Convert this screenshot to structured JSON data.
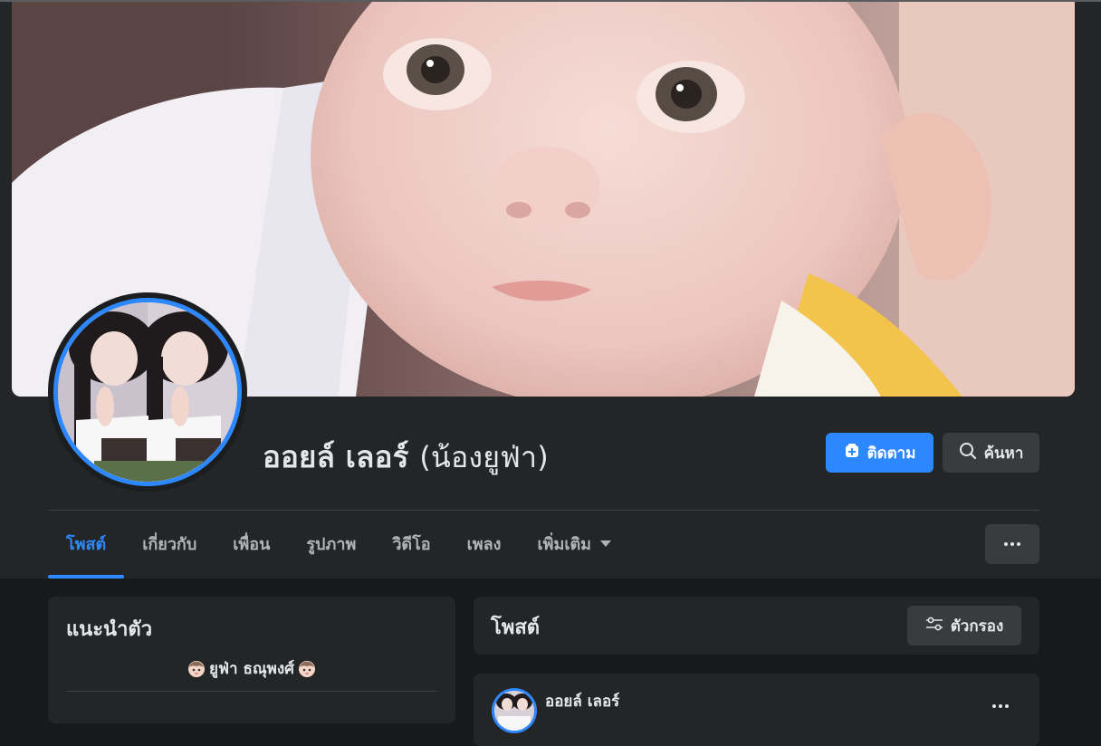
{
  "profile": {
    "name": "ออยล์ เลอร์",
    "alternate_name": "(น้องยูฟ่า)"
  },
  "actions": {
    "follow_label": "ติดตาม",
    "search_label": "ค้นหา"
  },
  "tabs": [
    {
      "label": "โพสต์",
      "active": true
    },
    {
      "label": "เกี่ยวกับ"
    },
    {
      "label": "เพื่อน"
    },
    {
      "label": "รูปภาพ"
    },
    {
      "label": "วิดีโอ"
    },
    {
      "label": "เพลง"
    },
    {
      "label": "เพิ่มเติม"
    }
  ],
  "intro": {
    "title": "แนะนำตัว",
    "bio": "ยูฟ่า ธณุพงศ์"
  },
  "posts": {
    "title": "โพสต์",
    "filter_label": "ตัวกรอง",
    "first_post": {
      "author": "ออยล์ เลอร์"
    }
  },
  "colors": {
    "accent": "#2d88ff",
    "background": "#18191a",
    "card": "#242526",
    "button": "#3a3b3c"
  },
  "icons": {
    "follow": "add-friend-icon",
    "search": "search-icon",
    "more": "more-dots-icon",
    "filter": "filter-sliders-icon",
    "bio_emoji": "baby-face-icon"
  }
}
